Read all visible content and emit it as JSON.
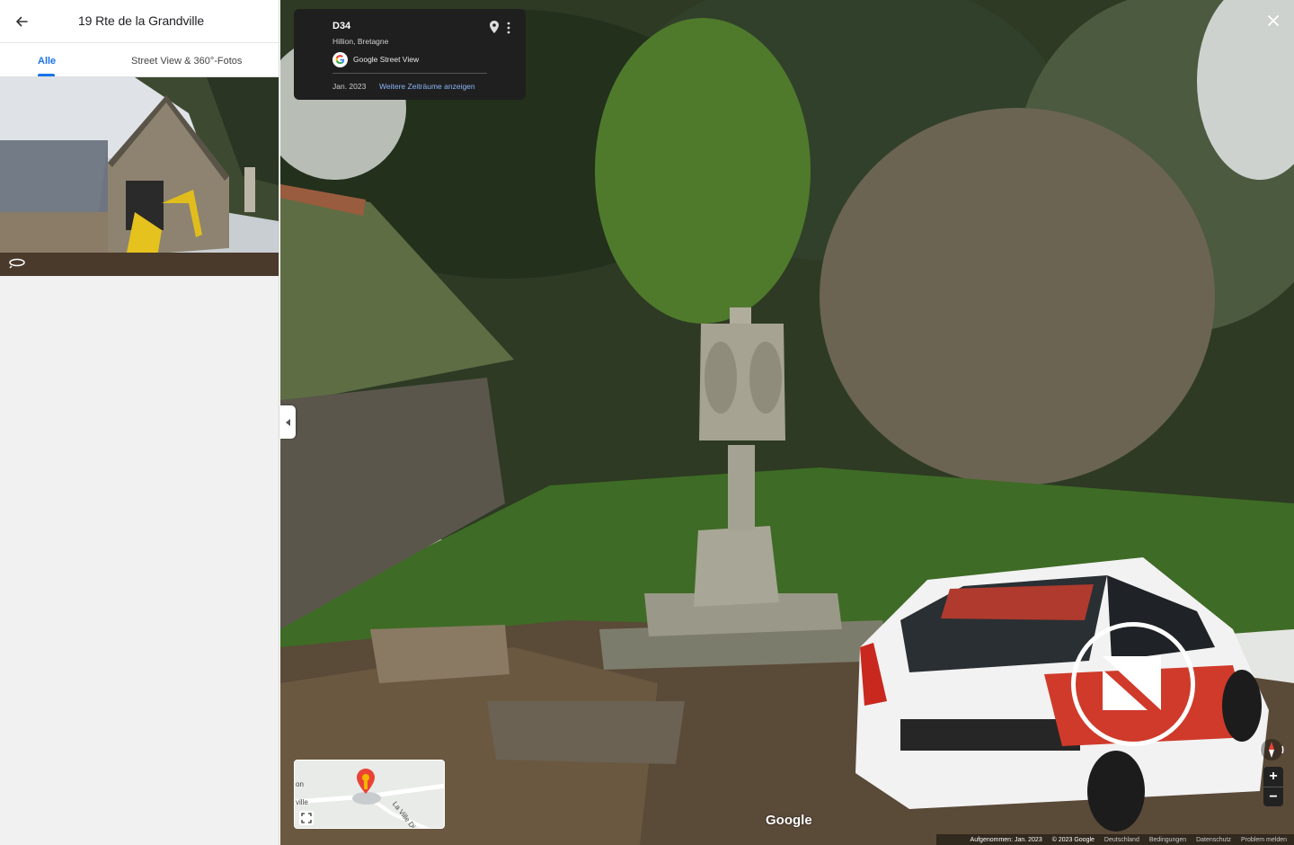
{
  "side": {
    "title": "19 Rte de la Grandville",
    "tabs": [
      {
        "label": "Alle",
        "active": true
      },
      {
        "label": "Street View & 360°-Fotos",
        "active": false
      }
    ]
  },
  "infocard": {
    "road": "D34",
    "location": "Hillion, Bretagne",
    "source": "Google Street View",
    "date": "Jan. 2023",
    "more_link": "Weitere Zeiträume anzeigen"
  },
  "minimap": {
    "labels": [
      "on",
      "ville",
      "La Ville Dier"
    ]
  },
  "brand": "Google",
  "footer": {
    "captured": "Aufgenommen: Jan. 2023",
    "copyright": "© 2023 Google",
    "country": "Deutschland",
    "terms": "Bedingungen",
    "privacy": "Datenschutz",
    "report": "Problem melden"
  },
  "colors": {
    "accent": "#1a73e8",
    "link": "#8ab4f8",
    "card_bg": "#1f1f1f",
    "pin_red": "#ea4335"
  }
}
